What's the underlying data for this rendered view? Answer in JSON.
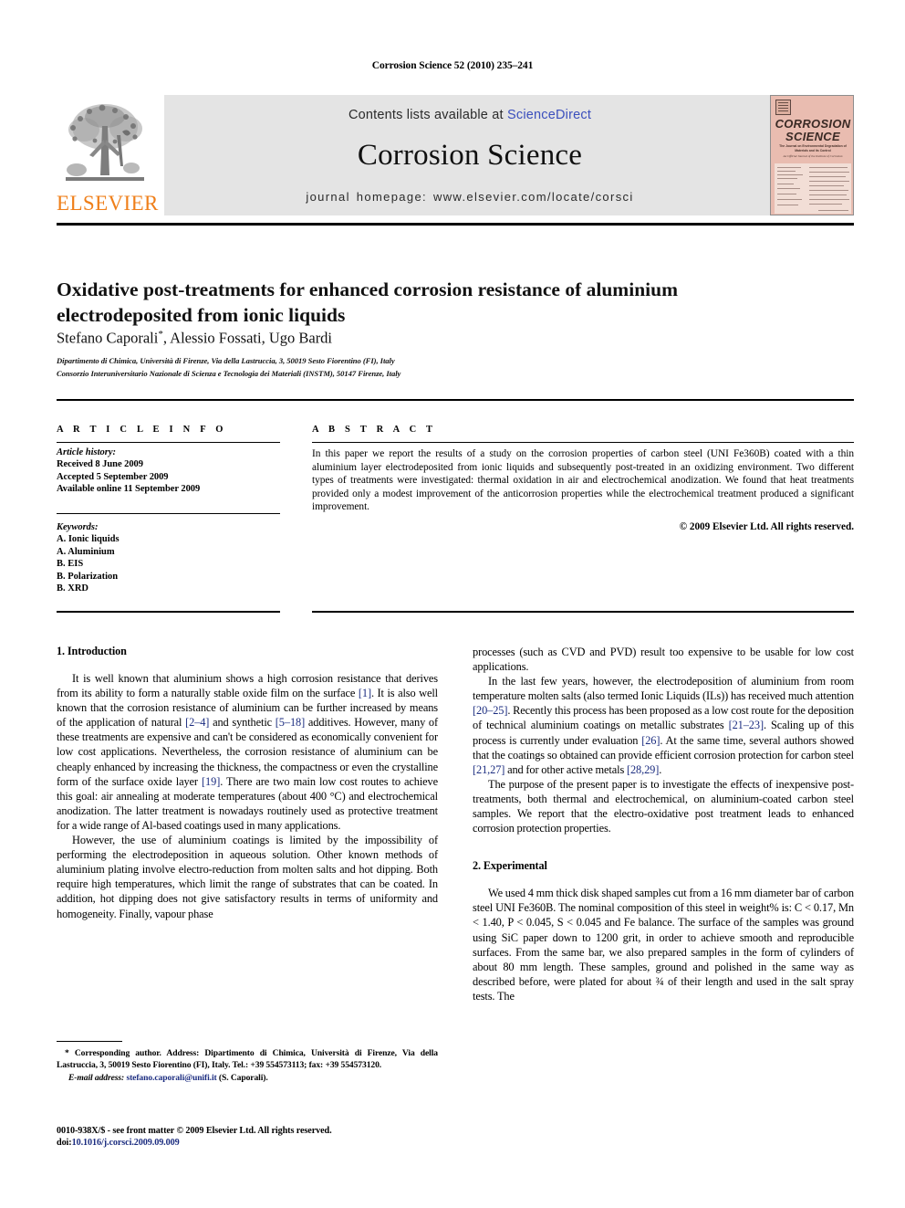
{
  "running_head": "Corrosion Science 52 (2010) 235–241",
  "masthead": {
    "publisher_word": "ELSEVIER",
    "contents_prefix": "Contents lists available at ",
    "sciencedirect_link": "ScienceDirect",
    "journal_name": "Corrosion Science",
    "homepage_line": "journal homepage: www.elsevier.com/locate/corsci",
    "cover": {
      "title_line1": "CORROSION",
      "title_line2": "SCIENCE",
      "subtitle": "The Journal on Environmental Degradation of Materials and its Control",
      "subtitle2": "An Official Journal of the Institute of Corrosion"
    }
  },
  "article": {
    "title": "Oxidative post-treatments for enhanced corrosion resistance of aluminium electrodeposited from ionic liquids",
    "authors": "Stefano Caporali",
    "author_marker": "*",
    "authors_rest": ", Alessio Fossati, Ugo Bardi",
    "affiliation_1": "Dipartimento di Chimica, Università di Firenze, Via della Lastruccia, 3, 50019 Sesto Fiorentino (FI), Italy",
    "affiliation_2": "Consorzio Interuniversitario Nazionale di Scienza e Tecnologia dei Materiali (INSTM), 50147 Firenze, Italy"
  },
  "info": {
    "heading": "A R T I C L E    I N F O",
    "history_label": "Article history:",
    "history": [
      "Received 8 June 2009",
      "Accepted 5 September 2009",
      "Available online 11 September 2009"
    ],
    "keywords_label": "Keywords:",
    "keywords": [
      "A. Ionic liquids",
      "A. Aluminium",
      "B. EIS",
      "B. Polarization",
      "B. XRD"
    ]
  },
  "abstract": {
    "heading": "A B S T R A C T",
    "text": "In this paper we report the results of a study on the corrosion properties of carbon steel (UNI Fe360B) coated with a thin aluminium layer electrodeposited from ionic liquids and subsequently post-treated in an oxidizing environment. Two different types of treatments were investigated: thermal oxidation in air and electrochemical anodization. We found that heat treatments provided only a modest improvement of the anticorrosion properties while the electrochemical treatment produced a significant improvement.",
    "copyright": "© 2009 Elsevier Ltd. All rights reserved."
  },
  "sections": {
    "introduction_heading": "1. Introduction",
    "experimental_heading": "2. Experimental"
  },
  "intro": {
    "p1_a": "It is well known that aluminium shows a high corrosion resistance that derives from its ability to form a naturally stable oxide film on the surface ",
    "r1": "[1]",
    "p1_b": ". It is also well known that the corrosion resistance of aluminium can be further increased by means of the application of natural ",
    "r2": "[2–4]",
    "p1_c": " and synthetic ",
    "r3": "[5–18]",
    "p1_d": " additives. However, many of these treatments are expensive and can't be considered as economically convenient for low cost applications. Nevertheless, the corrosion resistance of aluminium can be cheaply enhanced by increasing the thickness, the compactness or even the crystalline form of the surface oxide layer ",
    "r4": "[19]",
    "p1_e": ". There are two main low cost routes to achieve this goal: air annealing at moderate temperatures (about 400 °C) and electrochemical anodization. The latter treatment is nowadays routinely used as protective treatment for a wide range of Al-based coatings used in many applications.",
    "p2": "However, the use of aluminium coatings is limited by the impossibility of performing the electrodeposition in aqueous solution. Other known methods of aluminium plating involve electro-reduction from molten salts and hot dipping. Both require high temperatures, which limit the range of substrates that can be coated. In addition, hot dipping does not give satisfactory results in terms of uniformity and homogeneity. Finally, vapour phase",
    "p3": "processes (such as CVD and PVD) result too expensive to be usable for low cost applications.",
    "p4_a": "In the last few years, however, the electrodeposition of aluminium from room temperature molten salts (also termed Ionic Liquids (ILs)) has received much attention ",
    "r5": "[20–25]",
    "p4_b": ". Recently this process has been proposed as a low cost route for the deposition of technical aluminium coatings on metallic substrates ",
    "r6": "[21–23]",
    "p4_c": ". Scaling up of this process is currently under evaluation ",
    "r7": "[26]",
    "p4_d": ". At the same time, several authors showed that the coatings so obtained can provide efficient corrosion protection for carbon steel ",
    "r8": "[21,27]",
    "p4_e": " and for other active metals ",
    "r9": "[28,29]",
    "p4_f": ".",
    "p5": "The purpose of the present paper is to investigate the effects of inexpensive post-treatments, both thermal and electrochemical, on aluminium-coated carbon steel samples. We report that the electro-oxidative post treatment leads to enhanced corrosion protection properties."
  },
  "experimental": {
    "p1": "We used 4 mm thick disk shaped samples cut from a 16 mm diameter bar of carbon steel UNI Fe360B. The nominal composition of this steel in weight% is: C < 0.17, Mn < 1.40, P < 0.045, S < 0.045 and Fe balance. The surface of the samples was ground using SiC paper down to 1200 grit, in order to achieve smooth and reproducible surfaces. From the same bar, we also prepared samples in the form of cylinders of about 80 mm length. These samples, ground and polished in the same way as described before, were plated for about ¾ of their length and used in the salt spray tests. The"
  },
  "footnote": {
    "marker": "*",
    "corresponding": "Corresponding author. Address: Dipartimento di Chimica, Università di Firenze, Via della Lastruccia, 3, 50019 Sesto Fiorentino (FI), Italy. Tel.: +39 554573113; fax: +39 554573120.",
    "email_label": "E-mail address:",
    "email": "stefano.caporali@unifi.it",
    "email_suffix": " (S. Caporali)."
  },
  "page_footer": {
    "issn_line": "0010-938X/$ - see front matter © 2009 Elsevier Ltd. All rights reserved.",
    "doi_label": "doi:",
    "doi_value": "10.1016/j.corsci.2009.09.009"
  },
  "colors": {
    "link_blue": "#3b4fbd",
    "reference_blue": "#1c2d80",
    "elsevier_orange": "#ef7f1a",
    "banner_grey": "#e4e4e4",
    "cover_salmon": "#e9bcb0"
  }
}
